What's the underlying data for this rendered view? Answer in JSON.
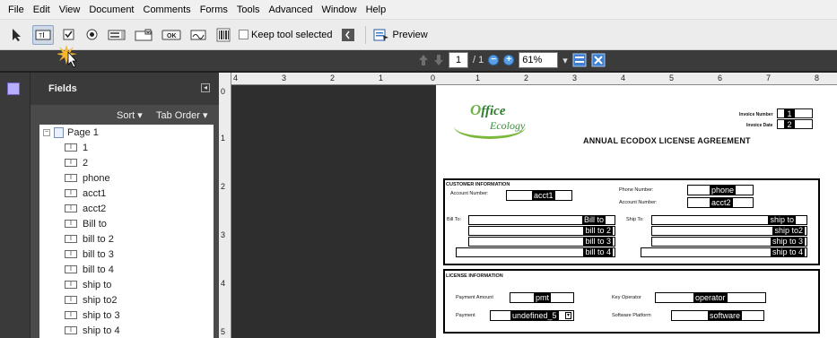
{
  "menubar": {
    "items": [
      "File",
      "Edit",
      "View",
      "Document",
      "Comments",
      "Forms",
      "Tools",
      "Advanced",
      "Window",
      "Help"
    ]
  },
  "toolbar": {
    "keep_tool_selected": "Keep tool selected",
    "preview": "Preview",
    "ok_label": "OK"
  },
  "navbar": {
    "page_current": "1",
    "page_total": "/ 1",
    "zoom": "61%"
  },
  "fields_panel": {
    "title": "Fields",
    "sort": "Sort ▾",
    "tab_order": "Tab Order ▾",
    "page_node": "Page 1",
    "field_items": [
      "1",
      "2",
      "phone",
      "acct1",
      "acct2",
      "Bill to",
      "bill to 2",
      "bill to 3",
      "bill to 4",
      "ship to",
      "ship to2",
      "ship to 3",
      "ship to 4"
    ]
  },
  "vruler": {
    "ticks": [
      "0",
      "1",
      "2",
      "3",
      "4",
      "5"
    ]
  },
  "hruler": {
    "ticks": [
      "4",
      "3",
      "2",
      "1",
      "0",
      "1",
      "2",
      "3",
      "4",
      "5",
      "6",
      "7",
      "8"
    ]
  },
  "document": {
    "logo_line1": "ffice",
    "logo_line2": "Ecology",
    "title": "ANNUAL ECODOX LICENSE AGREEMENT",
    "invoice_number_label": "Invoice Number",
    "invoice_date_label": "Invoice Date",
    "invoice_number_value": "1",
    "invoice_date_value": "2",
    "customer_section": "CUSTOMER INFORMATION",
    "account_number_label": "Account Number:",
    "account_number_value": "acct1",
    "phone_number_label": "Phone Number:",
    "phone_value": "phone",
    "account_number2_label": "Account Number:",
    "account_number2_value": "acct2",
    "bill_to_label": "Bill To:",
    "ship_to_label": "Ship To:",
    "bill_to": [
      "Bill to",
      "bill to 2",
      "bill to 3",
      "bill to 4"
    ],
    "ship_to": [
      "ship to",
      "ship to2",
      "ship to 3",
      "ship to 4"
    ],
    "license_section": "LICENSE INFORMATION",
    "payment_amount_label": "Payment Amount",
    "payment_amount_value": "pmt",
    "key_operator_label": "Key Operator",
    "key_operator_value": "operator",
    "payment_label": "Payment",
    "payment_value": "undefined_5",
    "software_platform_label": "Software Platform",
    "software_platform_value": "software"
  },
  "colors": {
    "workspace": "#2e2e2e",
    "panel": "#4a4a4a",
    "accent_blue": "#5aa0e6",
    "logo_green": "#2d7d2d"
  }
}
